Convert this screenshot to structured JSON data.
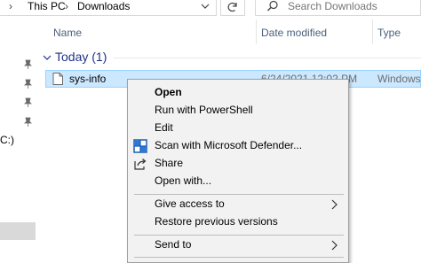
{
  "address_bar": {
    "crumbs": [
      "This PC",
      "Downloads"
    ]
  },
  "search": {
    "placeholder": "Search Downloads"
  },
  "nav": {
    "drive_label": "C:)"
  },
  "columns": {
    "name": "Name",
    "date_modified": "Date modified",
    "type": "Type"
  },
  "group": {
    "label": "Today (1)"
  },
  "file": {
    "name": "sys-info",
    "date_modified": "6/24/2021 12:02 PM",
    "type": "Windows I"
  },
  "context_menu": {
    "items": [
      {
        "label": "Open",
        "bold": true
      },
      {
        "label": "Run with PowerShell"
      },
      {
        "label": "Edit"
      },
      {
        "label": "Scan with Microsoft Defender...",
        "icon": "defender-icon"
      },
      {
        "label": "Share",
        "icon": "share-icon"
      },
      {
        "label": "Open with..."
      },
      {
        "label": "Give access to",
        "submenu": true
      },
      {
        "label": "Restore previous versions"
      },
      {
        "label": "Send to",
        "submenu": true
      }
    ]
  },
  "colors": {
    "selection_fill": "#cce8ff",
    "selection_border": "#99d1ff",
    "group_header": "#1e3287",
    "column_header": "#4c607a",
    "menu_background": "#f2f2f2"
  }
}
